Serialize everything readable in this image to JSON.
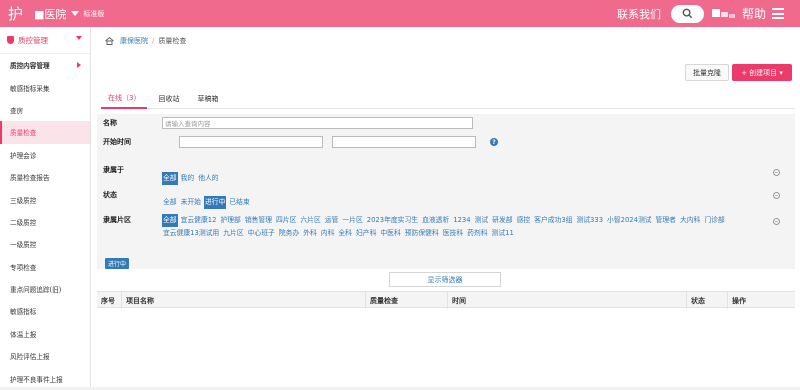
{
  "topbar": {
    "logo": "护",
    "hospital": "■医院",
    "edition": "标准版",
    "contact": "联系我们",
    "help": "帮助",
    "colors": {
      "brand": "#f06a8e",
      "accent": "#ec3a6b",
      "link": "#337ab7"
    }
  },
  "sidebar": {
    "header": "质控管理",
    "items": [
      {
        "label": "质控内容管理",
        "bold": true,
        "arrow": true
      },
      {
        "label": "敏感指标采集"
      },
      {
        "label": "查房"
      },
      {
        "label": "质量检查",
        "active": true
      },
      {
        "label": "护理会诊"
      },
      {
        "label": "质量检查报告"
      },
      {
        "label": "三级质控"
      },
      {
        "label": "二级质控"
      },
      {
        "label": "一级质控"
      },
      {
        "label": "专项检查"
      },
      {
        "label": "重点问题追踪(旧)"
      },
      {
        "label": "敏感指标"
      },
      {
        "label": "体温上报"
      },
      {
        "label": "风险评估上报"
      },
      {
        "label": "护理不良事件上报"
      }
    ]
  },
  "breadcrumb": {
    "hospital": "康保医院",
    "sep": "/",
    "page": "质量检查"
  },
  "toolbar": {
    "batch_clone": "批量克隆",
    "create": "+ 创建项目 ▾"
  },
  "tabs": [
    {
      "label": "在线（3）",
      "active": true
    },
    {
      "label": "回收站"
    },
    {
      "label": "草稿箱"
    }
  ],
  "filter": {
    "name_label": "名称",
    "name_placeholder": "请输入查询内容",
    "time_label": "开始时间",
    "help_glyph": "?",
    "belong_label": "隶属于",
    "belong_options": [
      {
        "label": "全部",
        "selected": true
      },
      {
        "label": "我的"
      },
      {
        "label": "他人的"
      }
    ],
    "status_label": "状态",
    "status_options": [
      {
        "label": "全部"
      },
      {
        "label": "未开始"
      },
      {
        "label": "进行中",
        "selected": true
      },
      {
        "label": "已结束"
      }
    ],
    "area_label": "隶属片区",
    "area_options": [
      {
        "label": "全部",
        "selected": true
      },
      {
        "label": "宜云健康12"
      },
      {
        "label": "护理部"
      },
      {
        "label": "销售管理"
      },
      {
        "label": "四片区"
      },
      {
        "label": "六片区"
      },
      {
        "label": "运管"
      },
      {
        "label": "一片区"
      },
      {
        "label": "2023年度实习生"
      },
      {
        "label": "血液透析"
      },
      {
        "label": "1234"
      },
      {
        "label": "测试"
      },
      {
        "label": "研发部"
      },
      {
        "label": "感控"
      },
      {
        "label": "客户成功3组"
      },
      {
        "label": "测试333"
      },
      {
        "label": "小智2024测试"
      },
      {
        "label": "管理者"
      },
      {
        "label": "大内科"
      },
      {
        "label": "门诊部"
      },
      {
        "label": "宜云健康13测试用"
      },
      {
        "label": "九片区"
      },
      {
        "label": "中心班子"
      },
      {
        "label": "院务办"
      },
      {
        "label": "外科"
      },
      {
        "label": "内科"
      },
      {
        "label": "全科"
      },
      {
        "label": "妇产科"
      },
      {
        "label": "中医科"
      },
      {
        "label": "预防保健科"
      },
      {
        "label": "医技科"
      },
      {
        "label": "药剂科"
      },
      {
        "label": "测试11"
      }
    ],
    "active_tag": "进行中",
    "show_filter": "显示筛选器"
  },
  "table": {
    "headers": [
      "序号",
      "项目名称",
      "质量检查",
      "时间",
      "状态",
      "操作"
    ]
  }
}
